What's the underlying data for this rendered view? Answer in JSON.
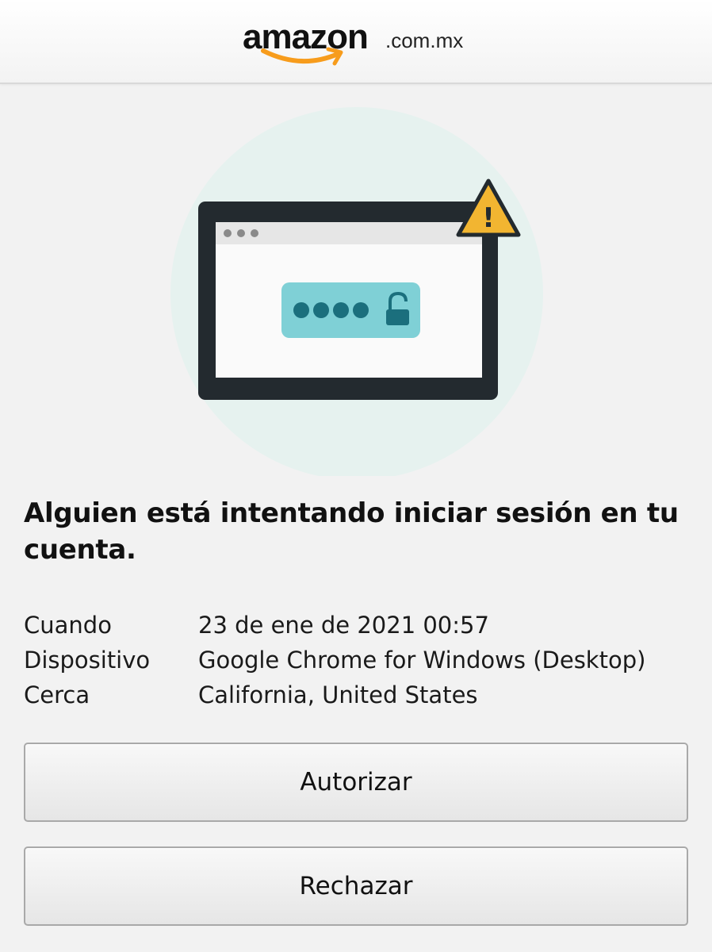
{
  "header": {
    "logo_word": "amazon",
    "logo_suffix": ".com.mx",
    "brand_color": "#f79c1c"
  },
  "illustration": {
    "icons": [
      "laptop-window-icon",
      "password-dots-icon",
      "unlocked-padlock-icon",
      "warning-triangle-icon"
    ],
    "colors": {
      "halo": "#e6f2ef",
      "frame": "#232a2f",
      "warning": "#f2b531",
      "password_field": "#7fd0d6",
      "dots": "#1b6f7d"
    },
    "warning_mark": "!"
  },
  "alert": {
    "title": "Alguien está intentando iniciar sesión en tu cuenta."
  },
  "details": [
    {
      "label": "Cuando",
      "value": "23 de ene de 2021 00:57"
    },
    {
      "label": "Dispositivo",
      "value": "Google Chrome for Windows (Desktop)"
    },
    {
      "label": "Cerca",
      "value": "California, United States"
    }
  ],
  "actions": {
    "authorize_label": "Autorizar",
    "reject_label": "Rechazar"
  }
}
